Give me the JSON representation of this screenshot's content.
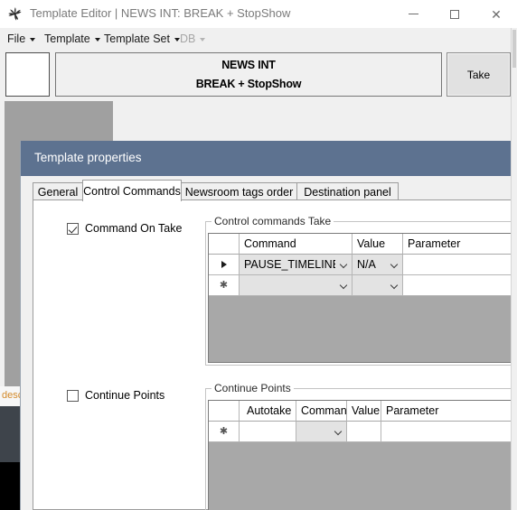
{
  "window": {
    "title": "Template Editor | NEWS INT: BREAK + StopShow",
    "icon": "pinwheel-icon",
    "controls": {
      "minimize": "minimize-icon",
      "maximize": "maximize-icon",
      "close": "close-icon"
    }
  },
  "menubar": {
    "items": [
      {
        "label": "File",
        "disabled": false
      },
      {
        "label": "Template",
        "disabled": false
      },
      {
        "label": "Template Set",
        "disabled": false
      },
      {
        "label": "DB",
        "disabled": true
      }
    ]
  },
  "header": {
    "thumbnail": "template-thumbnail",
    "name_line1": "NEWS INT",
    "name_line2": "BREAK + StopShow",
    "take_label": "Take"
  },
  "background": {
    "desc_text": "desc"
  },
  "dialog": {
    "title": "Template properties",
    "tabs": [
      {
        "label": "General",
        "active": false
      },
      {
        "label": "Control Commands",
        "active": true
      },
      {
        "label": "Newsroom tags order",
        "active": false
      },
      {
        "label": "Destination panel",
        "active": false
      }
    ],
    "command_on_take": {
      "label": "Command On Take",
      "checked": true
    },
    "control_commands_take": {
      "group_title": "Control commands Take",
      "columns": [
        "",
        "Command",
        "Value",
        "Parameter"
      ],
      "rows": [
        {
          "marker": "current-row-arrow",
          "command": "PAUSE_TIMELINE",
          "value": "N/A",
          "parameter": ""
        },
        {
          "marker": "new-row-asterisk",
          "command": "",
          "value": "",
          "parameter": ""
        }
      ]
    },
    "continue_points": {
      "label": "Continue Points",
      "checked": false
    },
    "continue_points_grid": {
      "group_title": "Continue Points",
      "columns": [
        "",
        "Autotake",
        "Command",
        "Value",
        "Parameter"
      ],
      "rows": [
        {
          "marker": "new-row-asterisk",
          "autotake": "",
          "command": "",
          "value": "",
          "parameter": ""
        }
      ]
    }
  },
  "colors": {
    "dialog_title_bar": "#5d7290",
    "window_chrome": "#f0f0f0",
    "grid_empty": "#a8a8a8",
    "desc_text": "#d38a2a"
  }
}
